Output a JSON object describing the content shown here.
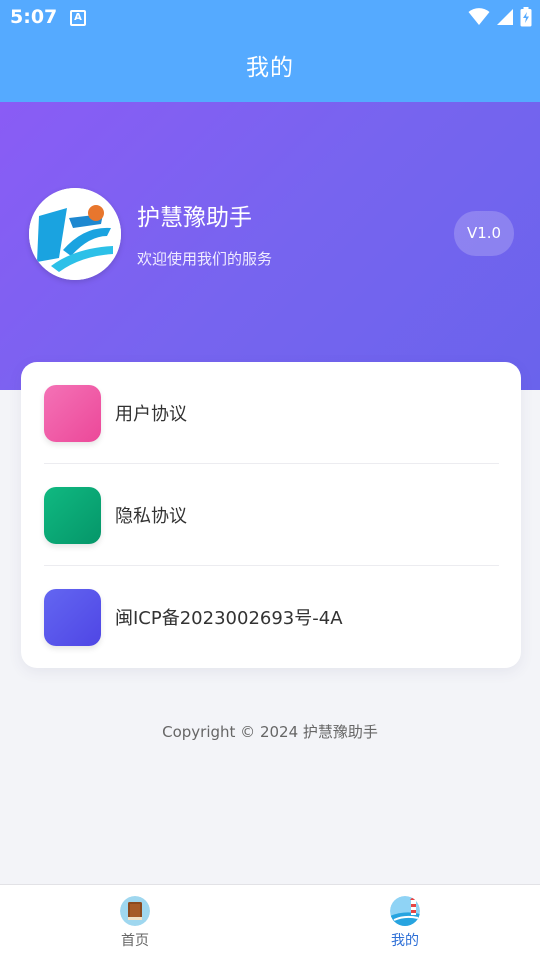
{
  "status_bar": {
    "time": "5:07",
    "a_badge": "A"
  },
  "header": {
    "title": "我的"
  },
  "profile": {
    "app_name": "护慧豫助手",
    "subtitle": "欢迎使用我们的服务",
    "version": "V1.0"
  },
  "menu": {
    "items": [
      {
        "label": "用户协议",
        "color_from": "#f472b6",
        "color_to": "#ec4899"
      },
      {
        "label": "隐私协议",
        "color_from": "#10b981",
        "color_to": "#059669"
      },
      {
        "label": "闽ICP备2023002693号-4A",
        "color_from": "#6366f1",
        "color_to": "#4f46e5"
      }
    ]
  },
  "footer": {
    "copyright": "Copyright © 2024 护慧豫助手"
  },
  "bottom_nav": {
    "tabs": [
      {
        "label": "首页",
        "icon": "book-icon",
        "active": false
      },
      {
        "label": "我的",
        "icon": "lighthouse-icon",
        "active": true
      }
    ],
    "active_color": "#2d6fd6",
    "inactive_color": "#666666"
  },
  "colors": {
    "header_bg": "#55aaff",
    "hero_gradient_start": "#8a5cf5",
    "hero_gradient_end": "#6a63ec"
  }
}
